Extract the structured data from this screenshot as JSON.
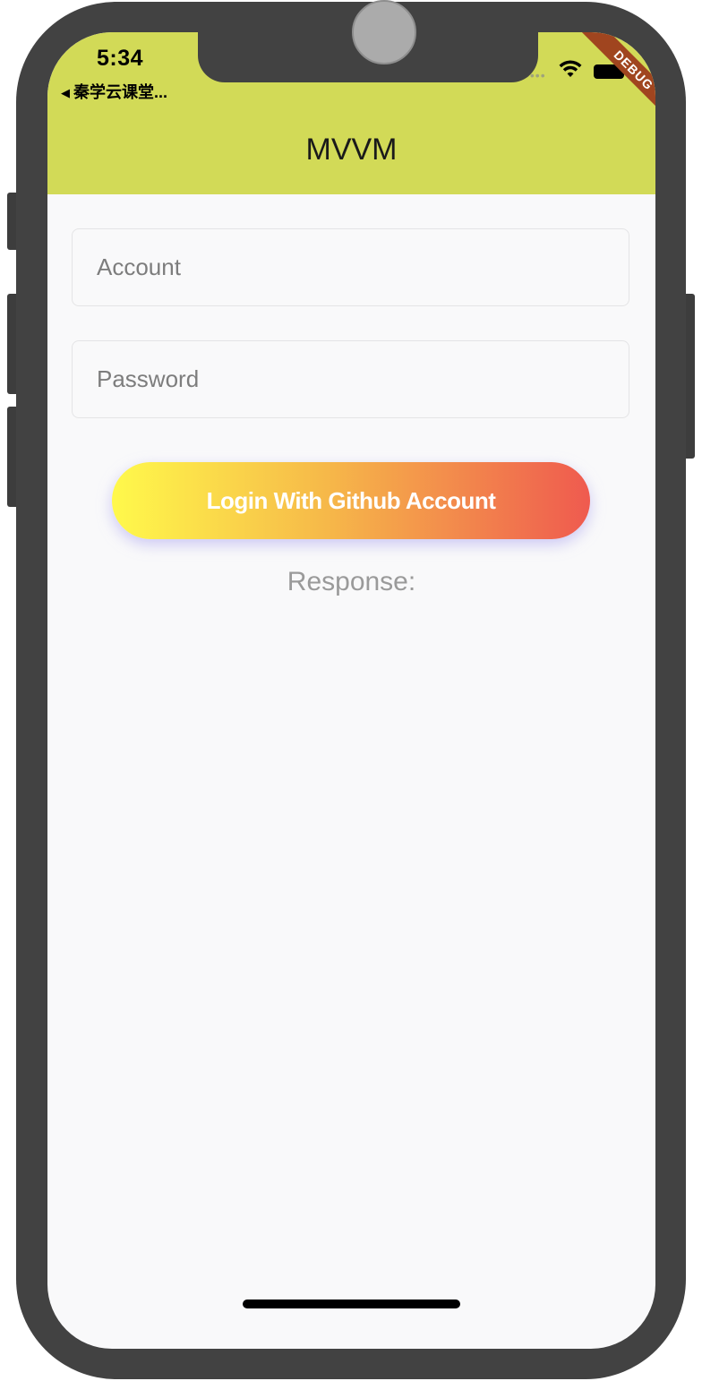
{
  "status_bar": {
    "time": "5:34",
    "back_app": "秦学云课堂...",
    "back_arrow": "◀",
    "signal": "••••",
    "icons": [
      "wifi-icon",
      "battery-icon"
    ]
  },
  "debug_banner": "DEBUG",
  "app_bar": {
    "title": "MVVM",
    "color": "#d2da57"
  },
  "form": {
    "account_placeholder": "Account",
    "password_placeholder": "Password",
    "login_label": "Login With Github Account",
    "login_gradient": [
      "#fff94b",
      "#f6b849",
      "#ef5a4f"
    ]
  },
  "response_label": "Response:"
}
